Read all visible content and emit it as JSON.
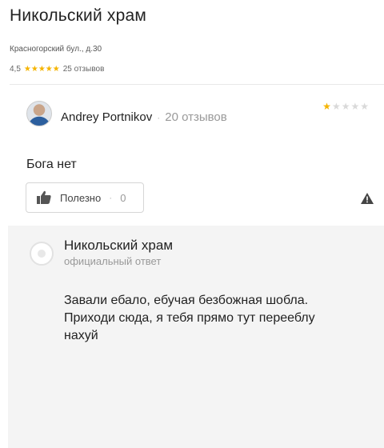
{
  "place": {
    "title": "Никольский храм",
    "address": "Красногорский бул., д.30",
    "rating_value": "4,5",
    "rating_stars": 4.5,
    "reviews_count": "25 отзывов"
  },
  "review": {
    "author": "Andrey Portnikov",
    "author_reviews": "20 отзывов",
    "rating_stars": 1,
    "text": "Бога нет",
    "useful_label": "Полезно",
    "useful_count": "0"
  },
  "reply": {
    "title": "Никольский храм",
    "subtitle": "официальный ответ",
    "lines": [
      "Завали ебало, ебучая безбожная шобла.",
      "Приходи сюда, я тебя прямо тут перееблу",
      "нахуй"
    ]
  },
  "colors": {
    "star": "#f5b400",
    "star_off": "#d9d9d9",
    "reply_bg": "#f4f4f4"
  }
}
